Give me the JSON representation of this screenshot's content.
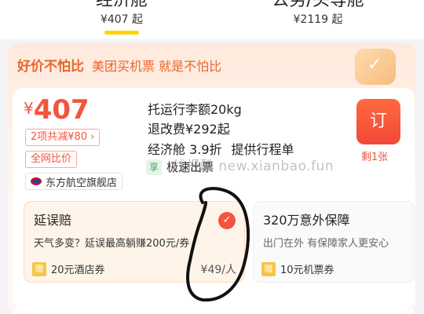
{
  "tabs": [
    {
      "name": "经济舱",
      "price": "¥407 起",
      "selected": true
    },
    {
      "name": "公务/头等舱",
      "price": "¥2119 起",
      "selected": false
    }
  ],
  "promo": {
    "badge": "好价不怕比",
    "subtitle": "美团买机票 就是不怕比"
  },
  "flight": {
    "currency": "¥",
    "price": "407",
    "discount_chip": "2项共减¥80 ›",
    "cheap_chip": "全网比价",
    "airline": "东方航空旗舰店",
    "baggage": "托运行李额20kg",
    "refund": "退改费¥292起",
    "cabin_discount": "经济舱 3.9折",
    "itinerary": "提供行程单",
    "fast_tag": "享",
    "fast_text": "极速出票",
    "book_label": "订",
    "remaining": "剩1张"
  },
  "watermark": "线报酷 new.xianbao.fun",
  "insurance": [
    {
      "title": "延误赔",
      "desc": "天气多变？延误最高躺赚200元/券",
      "gift_tag": "赠",
      "gift_text": "20元酒店券",
      "price": "¥49/人",
      "checked": true
    },
    {
      "title": "320万意外保障",
      "desc": "出门在外 有保障家人更安心",
      "gift_tag": "赠",
      "gift_text": "10元机票券",
      "price": ""
    }
  ],
  "colors": {
    "accent": "#f2553d",
    "tab_underline": "#ffd400",
    "promo": "#e8672c"
  }
}
